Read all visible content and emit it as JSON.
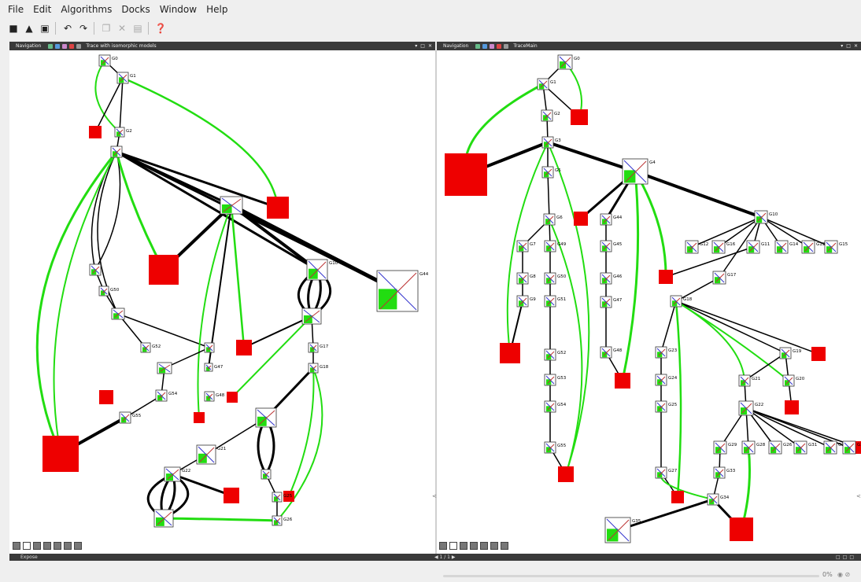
{
  "menu": {
    "items": [
      "File",
      "Edit",
      "Algorithms",
      "Docks",
      "Window",
      "Help"
    ]
  },
  "toolbar": {
    "icons": [
      "new-file-icon",
      "open-folder-icon",
      "save-icon",
      "undo-icon",
      "redo-icon",
      "copy-icon",
      "cut-icon",
      "paste-icon",
      "help-icon"
    ]
  },
  "left_panel": {
    "nav_label": "Navigation",
    "title": "Trace with isomorphic models"
  },
  "right_panel": {
    "nav_label": "Navigation",
    "title": "TraceMain"
  },
  "expose": {
    "label": "Expose",
    "pages": "1 / 1"
  },
  "status": {
    "progress": "0%"
  },
  "left_graph": {
    "labels": [
      "G0",
      "G1",
      "G2",
      "G50",
      "G52",
      "G47",
      "G48",
      "G54",
      "G55",
      "G10",
      "G17",
      "G18",
      "G44",
      "G21",
      "G22",
      "G25",
      "G26"
    ]
  },
  "right_graph": {
    "labels": [
      "G0",
      "G1",
      "G2",
      "G3",
      "G5",
      "G4",
      "G6",
      "G7",
      "G49",
      "G8",
      "G50",
      "G9",
      "G51",
      "G52",
      "G53",
      "G54",
      "G55",
      "G44",
      "G45",
      "G46",
      "G47",
      "G48",
      "G10",
      "G12",
      "G16",
      "G11",
      "G14",
      "G13",
      "G15",
      "G17",
      "G18",
      "G23",
      "G19",
      "G24",
      "G21",
      "G20",
      "G25",
      "G22",
      "G28",
      "G29",
      "G26",
      "G31",
      "G32",
      "G30",
      "G27",
      "G33",
      "G34",
      "G35"
    ]
  },
  "colors": {
    "green": "#22dd11",
    "red": "#ee0000",
    "black": "#000000",
    "bar": "#3a3a3a"
  }
}
